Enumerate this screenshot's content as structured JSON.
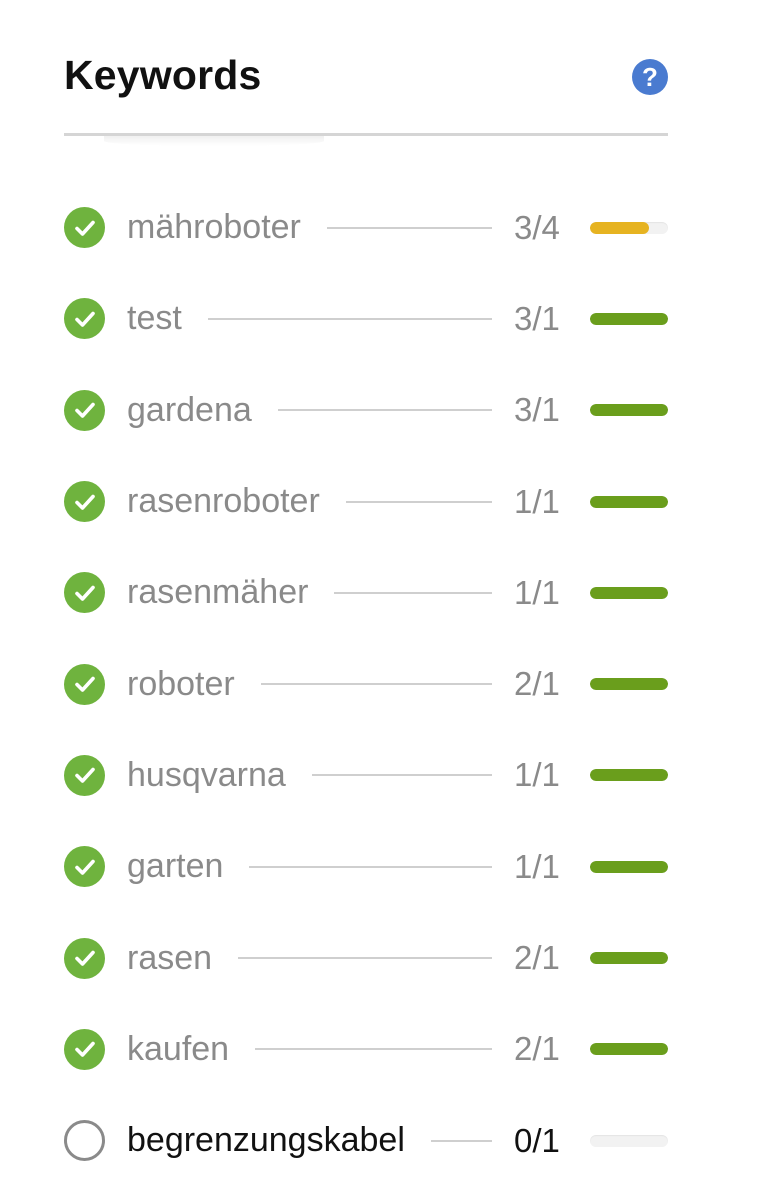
{
  "panel": {
    "title": "Keywords",
    "help_icon": "question-circle-icon",
    "help_glyph": "?"
  },
  "colors": {
    "done_icon": "#6fb33e",
    "bar_full": "#6a9e1c",
    "bar_partial": "#e6b321",
    "bar_track": "#f2f2f2"
  },
  "keywords": [
    {
      "label": "mähroboter",
      "count": "3/4",
      "found": true,
      "fill": 0.75,
      "bar_color": "#e6b321"
    },
    {
      "label": "test",
      "count": "3/1",
      "found": true,
      "fill": 1.0,
      "bar_color": "#6a9e1c"
    },
    {
      "label": "gardena",
      "count": "3/1",
      "found": true,
      "fill": 1.0,
      "bar_color": "#6a9e1c"
    },
    {
      "label": "rasenroboter",
      "count": "1/1",
      "found": true,
      "fill": 1.0,
      "bar_color": "#6a9e1c"
    },
    {
      "label": "rasenmäher",
      "count": "1/1",
      "found": true,
      "fill": 1.0,
      "bar_color": "#6a9e1c"
    },
    {
      "label": "roboter",
      "count": "2/1",
      "found": true,
      "fill": 1.0,
      "bar_color": "#6a9e1c"
    },
    {
      "label": "husqvarna",
      "count": "1/1",
      "found": true,
      "fill": 1.0,
      "bar_color": "#6a9e1c"
    },
    {
      "label": "garten",
      "count": "1/1",
      "found": true,
      "fill": 1.0,
      "bar_color": "#6a9e1c"
    },
    {
      "label": "rasen",
      "count": "2/1",
      "found": true,
      "fill": 1.0,
      "bar_color": "#6a9e1c"
    },
    {
      "label": "kaufen",
      "count": "2/1",
      "found": true,
      "fill": 1.0,
      "bar_color": "#6a9e1c"
    },
    {
      "label": "begrenzungskabel",
      "count": "0/1",
      "found": false,
      "fill": 0.0,
      "bar_color": "#6a9e1c"
    }
  ]
}
